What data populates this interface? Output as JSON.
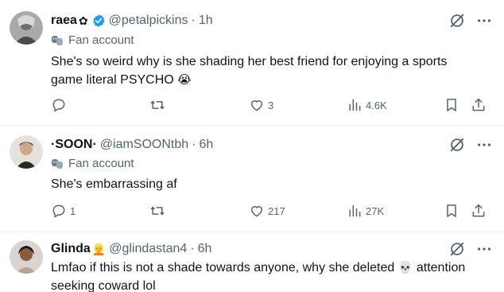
{
  "tweets": [
    {
      "name": "raea",
      "name_emoji": "✿",
      "handle": "@petalpickins",
      "time": "1h",
      "label": "Fan account",
      "text_line1": "She's so weird why is she shading her best friend for enjoying a sports",
      "text_line2": "game literal PSYCHO",
      "text_emoji": "😭",
      "replies": "",
      "retweets": "",
      "likes": "3",
      "views": "4.6K"
    },
    {
      "name": "·SOON·",
      "handle": "@iamSOONtbh",
      "time": "6h",
      "label": "Fan account",
      "text_line1": "She's embarrassing af",
      "replies": "1",
      "retweets": "",
      "likes": "217",
      "views": "27K"
    },
    {
      "name": "Glinda",
      "name_emoji": "👱",
      "handle": "@glindastan4",
      "time": "6h",
      "text_line1": "Lmfao if this is not a shade towards anyone, why she deleted",
      "text_emoji": "💀",
      "text_line1_end": "attention",
      "text_line2": "seeking coward lol"
    }
  ],
  "separator": "·",
  "colors": {
    "text": "#0f1419",
    "secondary": "#536471",
    "verified": "#1d9bf0",
    "border": "#eff3f4"
  },
  "icons": [
    "grok-icon",
    "more-icon",
    "masks-icon",
    "reply-icon",
    "retweet-icon",
    "like-icon",
    "views-icon",
    "bookmark-icon",
    "share-icon"
  ]
}
